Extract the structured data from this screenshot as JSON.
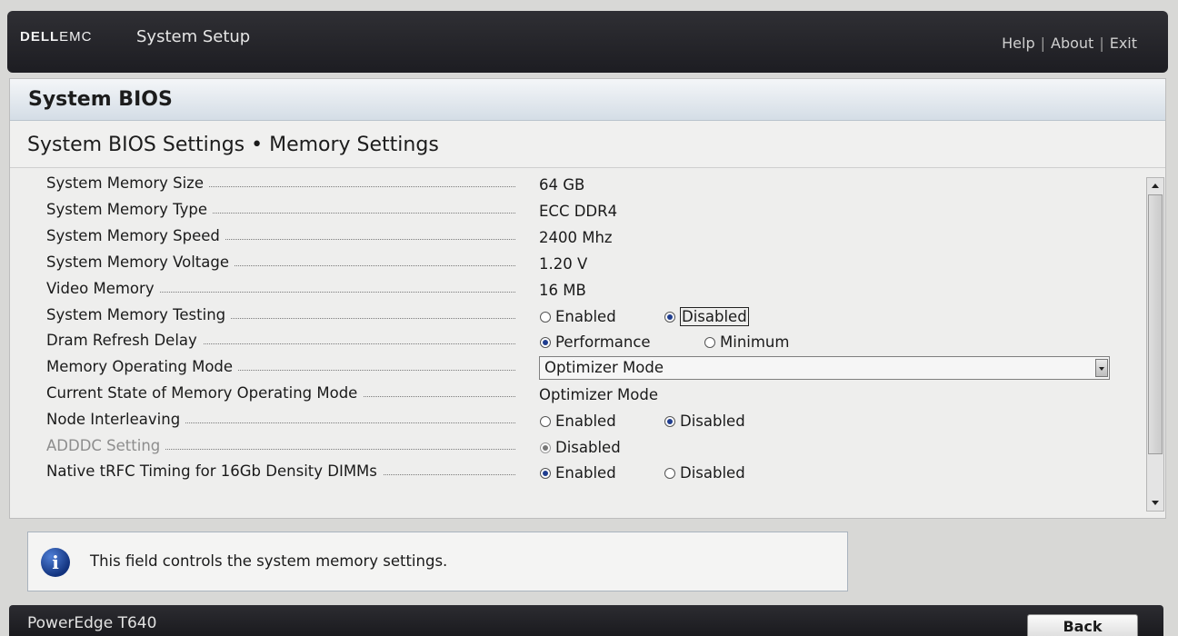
{
  "header": {
    "brand_dell": "DELL",
    "brand_emc": "EMC",
    "app_title": "System Setup",
    "links": [
      "Help",
      "About",
      "Exit"
    ],
    "separator": "|"
  },
  "panel": {
    "title": "System BIOS",
    "breadcrumb": "System BIOS Settings • Memory Settings"
  },
  "settings": {
    "memory_size": {
      "label": "System Memory Size",
      "value": "64 GB"
    },
    "memory_type": {
      "label": "System Memory Type",
      "value": "ECC DDR4"
    },
    "memory_speed": {
      "label": "System Memory Speed",
      "value": "2400 Mhz"
    },
    "memory_voltage": {
      "label": "System Memory Voltage",
      "value": "1.20 V"
    },
    "video_memory": {
      "label": "Video Memory",
      "value": "16 MB"
    },
    "memory_testing": {
      "label": "System Memory Testing",
      "options": [
        "Enabled",
        "Disabled"
      ],
      "selected": "Disabled"
    },
    "dram_refresh": {
      "label": "Dram Refresh Delay",
      "options": [
        "Performance",
        "Minimum"
      ],
      "selected": "Performance"
    },
    "operating_mode": {
      "label": "Memory Operating Mode",
      "value": "Optimizer Mode"
    },
    "current_mode": {
      "label": "Current State of Memory Operating Mode",
      "value": "Optimizer Mode"
    },
    "node_interleaving": {
      "label": "Node Interleaving",
      "options": [
        "Enabled",
        "Disabled"
      ],
      "selected": "Disabled"
    },
    "adddc": {
      "label": "ADDDC Setting",
      "options": [
        "Disabled"
      ],
      "selected": "Disabled"
    },
    "trfc": {
      "label": "Native tRFC Timing for 16Gb Density DIMMs",
      "options": [
        "Enabled",
        "Disabled"
      ],
      "selected": "Enabled"
    }
  },
  "help": {
    "icon": "info-icon",
    "text": "This field controls the system memory settings."
  },
  "footer": {
    "model": "PowerEdge T640",
    "back_label": "Back"
  },
  "colors": {
    "header_bg": "#26262b",
    "panel_bg": "#eeeeed",
    "radio_fill": "#1f3d8f",
    "info_icon": "#1d4aa8"
  }
}
